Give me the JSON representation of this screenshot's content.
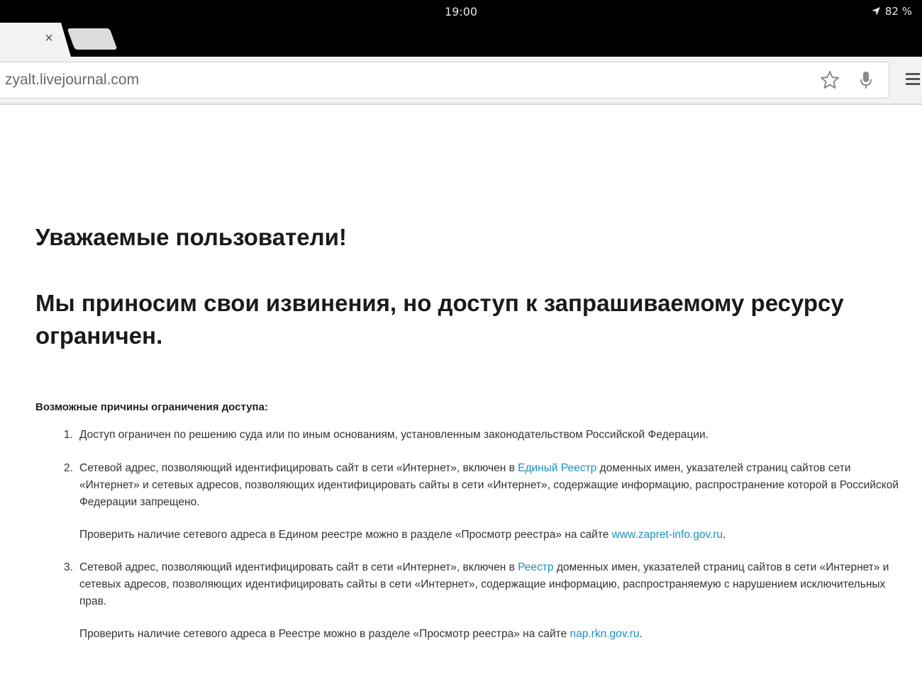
{
  "status_bar": {
    "time": "19:00",
    "battery": "82 %"
  },
  "browser": {
    "tab_close": "×",
    "url": "zyalt.livejournal.com"
  },
  "page": {
    "heading1": "Уважаемые пользователи!",
    "heading2": "Мы приносим свои извинения, но доступ к запрашиваемому ресурсу ограничен.",
    "reasons_title": "Возможные причины ограничения доступа:",
    "reasons": [
      {
        "num": "1.",
        "text": "Доступ ограничен по решению суда или по иным основаниям, установленным законодательством Российской Федерации."
      },
      {
        "num": "2.",
        "text_before": "Сетевой адрес, позволяющий идентифицировать сайт в сети «Интернет», включен в ",
        "link": "Единый Реестр",
        "text_after": " доменных имен, указателей страниц сайтов сети «Интернет» и сетевых адресов, позволяющих идентифицировать сайты в сети «Интернет», содержащие информацию, распространение которой в Российской Федерации запрещено.",
        "check_before": "Проверить наличие сетевого адреса в Едином реестре можно в разделе «Просмотр реестра» на сайте ",
        "check_link": "www.zapret-info.gov.ru",
        "check_after": "."
      },
      {
        "num": "3.",
        "text_before": "Сетевой адрес, позволяющий идентифицировать сайт в сети «Интернет», включен в ",
        "link": "Реестр",
        "text_after": " доменных имен, указателей страниц сайтов в сети «Интернет» и сетевых адресов, позволяющих идентифицировать сайты в сети «Интернет», содержащие информацию, распространяемую с нарушением исключительных прав.",
        "check_before": "Проверить наличие сетевого адреса в Реестре можно в разделе «Просмотр реестра» на сайте ",
        "check_link": "nap.rkn.gov.ru",
        "check_after": "."
      }
    ]
  },
  "colors": {
    "link": "#1e8fbf",
    "topbar": "#000000",
    "toolbar": "#f2f2f2"
  }
}
